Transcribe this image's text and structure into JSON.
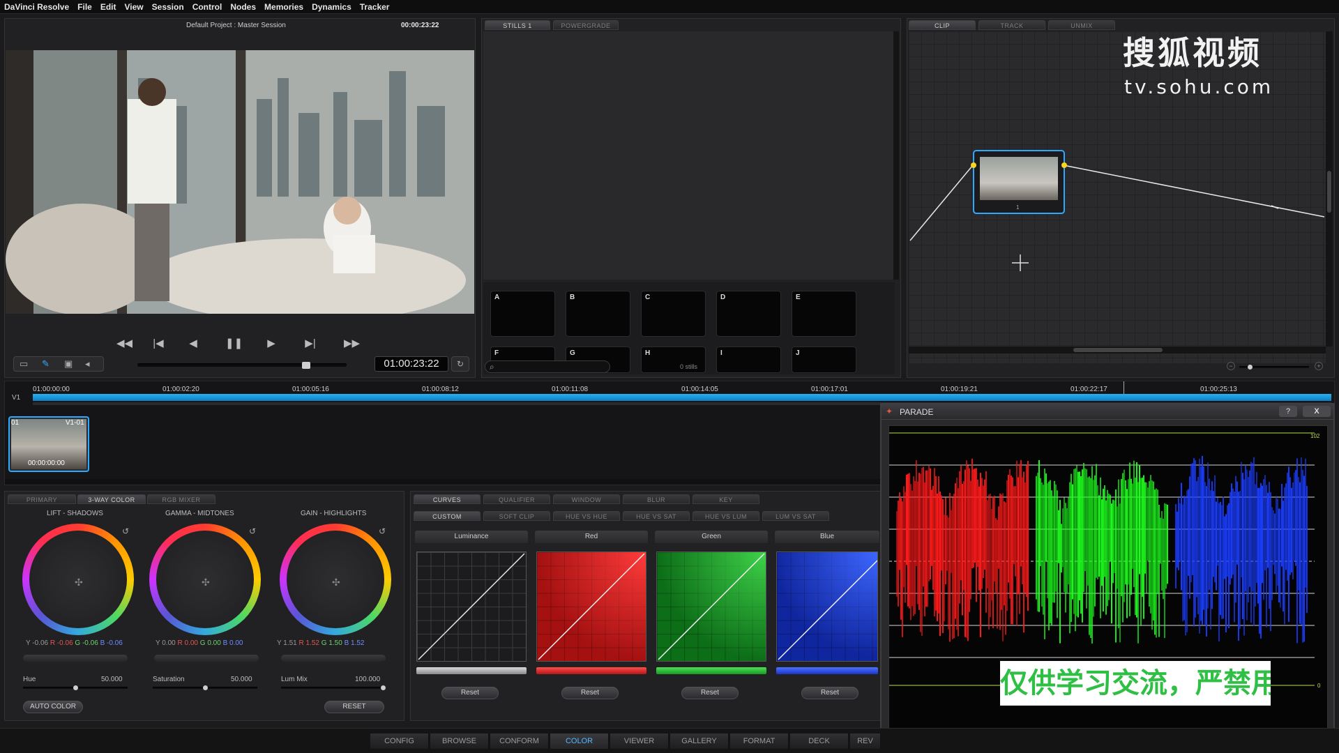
{
  "app": {
    "name": "DaVinci Resolve",
    "menu": [
      "File",
      "Edit",
      "View",
      "Session",
      "Control",
      "Nodes",
      "Memories",
      "Dynamics",
      "Tracker"
    ]
  },
  "viewer": {
    "title": "Default Project : Master Session",
    "timecode_top": "00:00:23:22",
    "timecode": "01:00:23:22",
    "scrub_position": 0.82
  },
  "gallery": {
    "tabs": [
      "STILLS 1",
      "POWERGRADE"
    ],
    "stills": [
      "A",
      "B",
      "C",
      "D",
      "E",
      "F",
      "G",
      "H",
      "I",
      "J"
    ],
    "count_label": "0 stills"
  },
  "node_editor": {
    "tabs": [
      "CLIP",
      "TRACK",
      "UNMIX"
    ],
    "node_label": "1"
  },
  "watermark": {
    "logo": "搜狐视频",
    "url": "tv.sohu.com",
    "notice": "仅供学习交流，严禁用于商业"
  },
  "timeline": {
    "track_label": "V1",
    "ticks": [
      "01:00:00:00",
      "01:00:02:20",
      "01:00:05:16",
      "01:00:08:12",
      "01:00:11:08",
      "01:00:14:05",
      "01:00:17:01",
      "01:00:19:21",
      "01:00:22:17",
      "01:00:25:13"
    ],
    "clip": {
      "index": "01",
      "name": "V1-01",
      "timecode": "00:00:00:00"
    }
  },
  "primary": {
    "tabs": [
      "PRIMARY",
      "3-WAY COLOR",
      "RGB MIXER"
    ],
    "wheels": [
      {
        "title": "LIFT - SHADOWS",
        "y": "Y -0.06",
        "r": "R -0.06",
        "g": "G -0.06",
        "b": "B -0.06"
      },
      {
        "title": "GAMMA - MIDTONES",
        "y": "Y 0.00",
        "r": "R 0.00",
        "g": "G 0.00",
        "b": "B 0.00"
      },
      {
        "title": "GAIN - HIGHLIGHTS",
        "y": "Y 1.51",
        "r": "R 1.52",
        "g": "G 1.50",
        "b": "B 1.52"
      }
    ],
    "sliders": [
      {
        "label": "Hue",
        "value": "50.000",
        "level": 0.5
      },
      {
        "label": "Saturation",
        "value": "50.000",
        "level": 0.5
      },
      {
        "label": "Lum Mix",
        "value": "100.000",
        "level": 1.0
      }
    ],
    "auto_color": "AUTO COLOR",
    "reset": "RESET"
  },
  "curves": {
    "tabs_top": [
      "CURVES",
      "QUALIFIER",
      "WINDOW",
      "BLUR",
      "KEY"
    ],
    "tabs_bottom": [
      "CUSTOM",
      "SOFT CLIP",
      "HUE VS HUE",
      "HUE VS SAT",
      "HUE VS LUM",
      "LUM VS SAT"
    ],
    "channels": [
      "Luminance",
      "Red",
      "Green",
      "Blue"
    ],
    "reset": "Reset",
    "colors": {
      "luminance": "#8a8a8a",
      "red": "#d21f1f",
      "green": "#1e9e2a",
      "blue": "#1f3fd8"
    }
  },
  "parade": {
    "title": "PARADE",
    "help": "?",
    "close": "X",
    "top_value": "102",
    "bottom_value": "0"
  },
  "pages": [
    "CONFIG",
    "BROWSE",
    "CONFORM",
    "COLOR",
    "VIEWER",
    "GALLERY",
    "FORMAT",
    "DECK",
    "REV"
  ],
  "active_page": "COLOR"
}
